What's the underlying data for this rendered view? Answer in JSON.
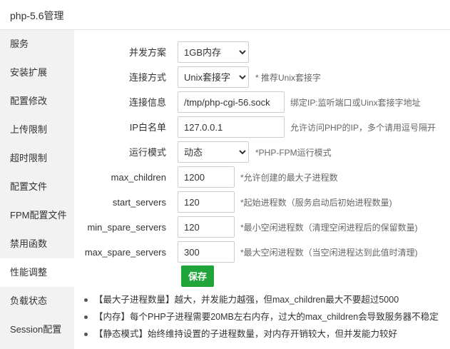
{
  "window": {
    "title": "php-5.6管理"
  },
  "sidebar": {
    "items": [
      {
        "label": "服务"
      },
      {
        "label": "安装扩展"
      },
      {
        "label": "配置修改"
      },
      {
        "label": "上传限制"
      },
      {
        "label": "超时限制"
      },
      {
        "label": "配置文件"
      },
      {
        "label": "FPM配置文件"
      },
      {
        "label": "禁用函数"
      },
      {
        "label": "性能调整",
        "active": true
      },
      {
        "label": "负载状态"
      },
      {
        "label": "Session配置"
      }
    ]
  },
  "form": {
    "concurrency": {
      "label": "并发方案",
      "value": "1GB内存"
    },
    "connection_method": {
      "label": "连接方式",
      "value": "Unix套接字",
      "hint": "* 推荐Unix套接字"
    },
    "connection_info": {
      "label": "连接信息",
      "value": "/tmp/php-cgi-56.sock",
      "hint": "绑定IP:监听端口或Uinx套接字地址"
    },
    "ip_whitelist": {
      "label": "IP白名单",
      "value": "127.0.0.1",
      "hint": "允许访问PHP的IP，多个请用逗号隔开"
    },
    "run_mode": {
      "label": "运行模式",
      "value": "动态",
      "hint": "*PHP-FPM运行模式"
    },
    "max_children": {
      "label": "max_children",
      "value": "1200",
      "hint": "*允许创建的最大子进程数"
    },
    "start_servers": {
      "label": "start_servers",
      "value": "120",
      "hint": "*起始进程数（服务启动后初始进程数量)"
    },
    "min_spare_servers": {
      "label": "min_spare_servers",
      "value": "120",
      "hint": "*最小空闲进程数（清理空闲进程后的保留数量)"
    },
    "max_spare_servers": {
      "label": "max_spare_servers",
      "value": "300",
      "hint": "*最大空闲进程数（当空闲进程达到此值时清理)"
    },
    "save_label": "保存"
  },
  "notes": [
    "【最大子进程数量】越大，并发能力越强，但max_children最大不要超过5000",
    "【内存】每个PHP子进程需要20MB左右内存，过大的max_children会导致服务器不稳定",
    "【静态模式】始终维持设置的子进程数量，对内存开销较大，但并发能力较好"
  ],
  "colors": {
    "accent": "#20a53a",
    "sidebar_bg": "#f2f2f2"
  }
}
